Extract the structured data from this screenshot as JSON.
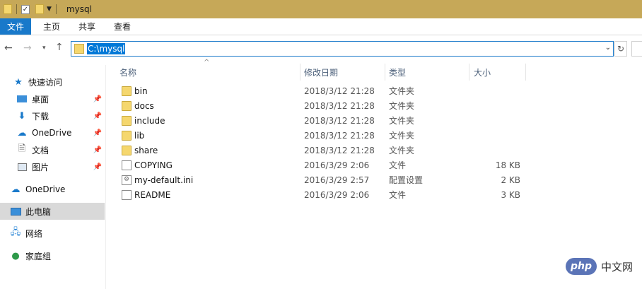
{
  "window": {
    "title": "mysql"
  },
  "ribbon": {
    "tabs": [
      "文件",
      "主页",
      "共享",
      "查看"
    ]
  },
  "address": {
    "path": "C:\\mysql"
  },
  "sidebar": {
    "items": [
      {
        "label": "快速访问",
        "icon": "star-icon"
      },
      {
        "label": "桌面",
        "icon": "desktop-icon",
        "pinned": true
      },
      {
        "label": "下载",
        "icon": "download-icon",
        "pinned": true
      },
      {
        "label": "OneDrive",
        "icon": "cloud-icon",
        "pinned": true
      },
      {
        "label": "文档",
        "icon": "document-icon",
        "pinned": true
      },
      {
        "label": "图片",
        "icon": "picture-icon",
        "pinned": true
      },
      {
        "label": "OneDrive",
        "icon": "cloud-icon"
      },
      {
        "label": "此电脑",
        "icon": "computer-icon",
        "selected": true
      },
      {
        "label": "网络",
        "icon": "network-icon"
      },
      {
        "label": "家庭组",
        "icon": "homegroup-icon"
      }
    ]
  },
  "columns": {
    "name": "名称",
    "date": "修改日期",
    "type": "类型",
    "size": "大小"
  },
  "files": [
    {
      "name": "bin",
      "date": "2018/3/12 21:28",
      "type": "文件夹",
      "size": "",
      "kind": "folder"
    },
    {
      "name": "docs",
      "date": "2018/3/12 21:28",
      "type": "文件夹",
      "size": "",
      "kind": "folder"
    },
    {
      "name": "include",
      "date": "2018/3/12 21:28",
      "type": "文件夹",
      "size": "",
      "kind": "folder"
    },
    {
      "name": "lib",
      "date": "2018/3/12 21:28",
      "type": "文件夹",
      "size": "",
      "kind": "folder"
    },
    {
      "name": "share",
      "date": "2018/3/12 21:28",
      "type": "文件夹",
      "size": "",
      "kind": "folder"
    },
    {
      "name": "COPYING",
      "date": "2016/3/29 2:06",
      "type": "文件",
      "size": "18 KB",
      "kind": "file"
    },
    {
      "name": "my-default.ini",
      "date": "2016/3/29 2:57",
      "type": "配置设置",
      "size": "2 KB",
      "kind": "ini"
    },
    {
      "name": "README",
      "date": "2016/3/29 2:06",
      "type": "文件",
      "size": "3 KB",
      "kind": "file"
    }
  ],
  "watermark": {
    "logo": "php",
    "text": "中文网"
  },
  "colors": {
    "titlebar": "#c6a858",
    "accent": "#1979ca",
    "selection": "#0078d7"
  }
}
